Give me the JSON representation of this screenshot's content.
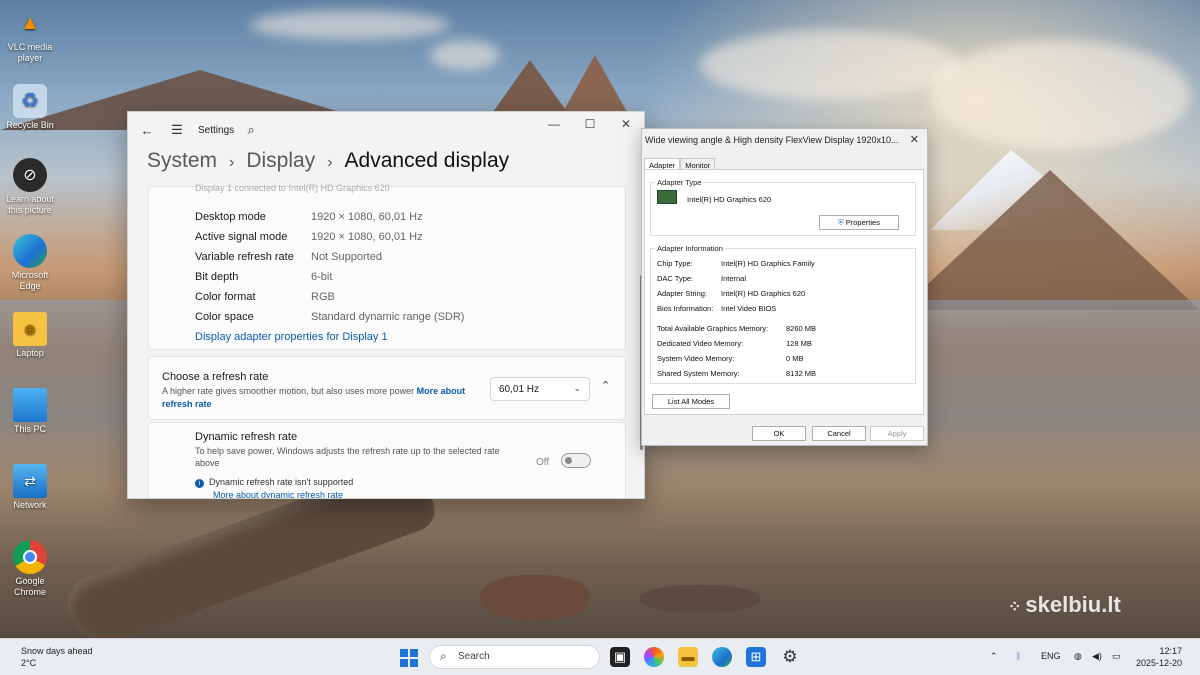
{
  "desktop": {
    "icons": [
      {
        "label": "VLC media player",
        "icon": "vlc-icon"
      },
      {
        "label": "Recycle Bin",
        "icon": "recycle-bin-icon"
      },
      {
        "label": "Learn about this picture",
        "icon": "learn-icon"
      },
      {
        "label": "Microsoft Edge",
        "icon": "edge-icon"
      },
      {
        "label": "Laptop",
        "icon": "folder-user-icon"
      },
      {
        "label": "This PC",
        "icon": "monitor-icon"
      },
      {
        "label": "Network",
        "icon": "network-icon"
      },
      {
        "label": "Google Chrome",
        "icon": "chrome-icon"
      }
    ],
    "watermark": "skelbiu.lt"
  },
  "settings": {
    "app_title": "Settings",
    "breadcrumb": {
      "level1": "System",
      "level2": "Display",
      "current": "Advanced display"
    },
    "cut_text": "Display 1 connected to Intel(R) HD Graphics 620",
    "info_rows": [
      {
        "label": "Desktop mode",
        "value": "1920 × 1080, 60,01 Hz"
      },
      {
        "label": "Active signal mode",
        "value": "1920 × 1080, 60,01 Hz"
      },
      {
        "label": "Variable refresh rate",
        "value": "Not Supported"
      },
      {
        "label": "Bit depth",
        "value": "6-bit"
      },
      {
        "label": "Color format",
        "value": "RGB"
      },
      {
        "label": "Color space",
        "value": "Standard dynamic range (SDR)"
      }
    ],
    "adapter_link": "Display adapter properties for Display 1",
    "refresh": {
      "title": "Choose a refresh rate",
      "desc": "A higher rate gives smoother motion, but also uses more power",
      "link": "More about refresh rate",
      "selected": "60,01 Hz"
    },
    "dynamic": {
      "title": "Dynamic refresh rate",
      "desc": "To help save power, Windows adjusts the refresh rate up to the selected rate above",
      "toggle_label": "Off",
      "note": "Dynamic refresh rate isn't supported",
      "link": "More about dynamic refresh rate"
    }
  },
  "adapter_dialog": {
    "title": "Wide viewing angle & High density FlexView Display 1920x10...",
    "tabs": [
      "Adapter",
      "Monitor"
    ],
    "adapter_type_label": "Adapter Type",
    "adapter_name": "Intel(R) HD Graphics 620",
    "properties_label": "Properties",
    "info_label": "Adapter Information",
    "info": [
      {
        "k": "Chip Type:",
        "v": "Intel(R) HD Graphics Family"
      },
      {
        "k": "DAC Type:",
        "v": "Internal"
      },
      {
        "k": "Adapter String:",
        "v": "Intel(R) HD Graphics 620"
      },
      {
        "k": "Bios Information:",
        "v": "Intel Video BIOS"
      }
    ],
    "memory": [
      {
        "k": "Total Available Graphics Memory:",
        "v": "8260 MB"
      },
      {
        "k": "Dedicated Video Memory:",
        "v": "128 MB"
      },
      {
        "k": "System Video Memory:",
        "v": "0 MB"
      },
      {
        "k": "Shared System Memory:",
        "v": "8132 MB"
      }
    ],
    "list_modes": "List All Modes",
    "ok": "OK",
    "cancel": "Cancel",
    "apply": "Apply"
  },
  "taskbar": {
    "weather_title": "Snow days ahead",
    "weather_temp": "2°C",
    "search_placeholder": "Search",
    "lang": "ENG",
    "time": "12:17",
    "date": "2025-12-20"
  }
}
